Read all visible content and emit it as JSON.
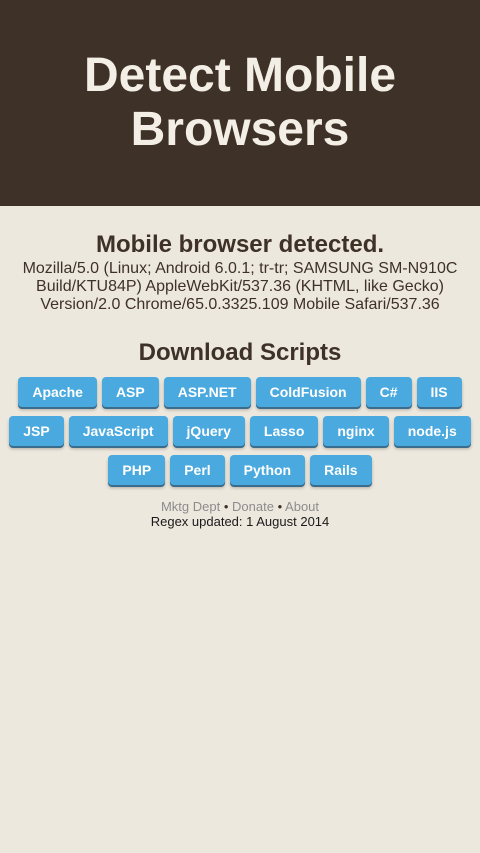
{
  "header": {
    "title_line1": "Detect Mobile",
    "title_line2": "Browsers"
  },
  "detection": {
    "heading": "Mobile browser detected.",
    "ua_line1": "Mozilla/5.0 (Linux; Android 6.0.1; tr-tr; SAMSUNG SM-N910C",
    "ua_line2": "Build/KTU84P) AppleWebKit/537.36 (KHTML, like Gecko)",
    "ua_line3": "Version/2.0 Chrome/65.0.3325.109 Mobile Safari/537.36"
  },
  "scripts": {
    "heading": "Download Scripts",
    "row1": [
      "Apache",
      "ASP",
      "ASP.NET",
      "ColdFusion",
      "C#",
      "IIS"
    ],
    "row2": [
      "JSP",
      "JavaScript",
      "jQuery",
      "Lasso",
      "nginx",
      "node.js"
    ],
    "row3": [
      "PHP",
      "Perl",
      "Python",
      "Rails"
    ]
  },
  "footer": {
    "link1": "Mktg Dept",
    "link2": "Donate",
    "link3": "About",
    "separator": "•",
    "updated": "Regex updated: 1 August 2014"
  },
  "colors": {
    "header_bg": "#3e3127",
    "page_bg": "#ede8de",
    "button_bg": "#4aa9de",
    "text": "#3e3127"
  }
}
